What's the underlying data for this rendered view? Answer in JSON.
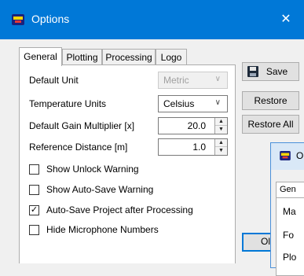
{
  "window": {
    "title": "Options",
    "close_glyph": "✕",
    "accent": "#0078d7"
  },
  "tabs": [
    {
      "label": "General"
    },
    {
      "label": "Plotting"
    },
    {
      "label": "Processing"
    },
    {
      "label": "Logo"
    }
  ],
  "general": {
    "default_unit": {
      "label": "Default Unit",
      "value": "Metric",
      "disabled": true
    },
    "temperature_units": {
      "label": "Temperature Units",
      "value": "Celsius"
    },
    "gain_multiplier": {
      "label": "Default Gain Multiplier [x]",
      "value": "20.0"
    },
    "reference_distance": {
      "label": "Reference Distance [m]",
      "value": "1.0"
    },
    "checkboxes": [
      {
        "label": "Show Unlock Warning",
        "checked": false
      },
      {
        "label": "Show Auto-Save Warning",
        "checked": false
      },
      {
        "label": "Auto-Save Project after Processing",
        "checked": true
      },
      {
        "label": "Hide Microphone Numbers",
        "checked": false
      }
    ]
  },
  "buttons": {
    "save": "Save",
    "restore": "Restore",
    "restore_all": "Restore All",
    "ok": "Ol"
  },
  "second_window": {
    "title": "O",
    "tab": "Gen",
    "rows": [
      "Ma",
      "Fo",
      "Plo"
    ]
  },
  "icons": {
    "app": "app-logo-icon",
    "save": "floppy-disk-icon",
    "chevron": "chevron-down-icon",
    "check": "checkmark-icon"
  }
}
